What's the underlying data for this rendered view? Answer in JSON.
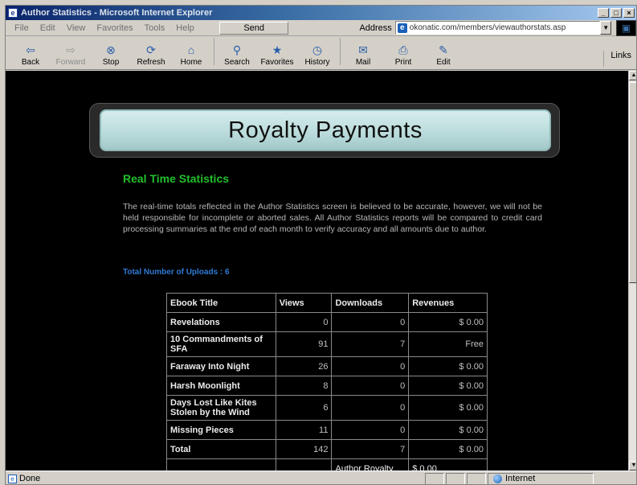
{
  "window": {
    "title": "Author Statistics - Microsoft Internet Explorer",
    "controls": [
      "_",
      "□",
      "×"
    ]
  },
  "menu": {
    "items": [
      "File",
      "Edit",
      "View",
      "Favorites",
      "Tools",
      "Help"
    ],
    "send_label": "Send",
    "address_label": "Address",
    "address_value": "okonatic.com/members/viewauthorstats.asp"
  },
  "toolbar": {
    "buttons": [
      {
        "label": "Back",
        "icon": "back-arrow-icon",
        "enabled": true
      },
      {
        "label": "Forward",
        "icon": "forward-arrow-icon",
        "enabled": false
      },
      {
        "label": "Stop",
        "icon": "stop-icon",
        "enabled": true
      },
      {
        "label": "Refresh",
        "icon": "refresh-icon",
        "enabled": true
      },
      {
        "label": "Home",
        "icon": "home-icon",
        "enabled": true
      },
      {
        "label": "Search",
        "icon": "search-icon",
        "enabled": true
      },
      {
        "label": "Favorites",
        "icon": "favorites-icon",
        "enabled": true
      },
      {
        "label": "History",
        "icon": "history-icon",
        "enabled": true
      },
      {
        "label": "Mail",
        "icon": "mail-icon",
        "enabled": true
      },
      {
        "label": "Print",
        "icon": "print-icon",
        "enabled": true
      },
      {
        "label": "Edit",
        "icon": "edit-icon",
        "enabled": true
      }
    ],
    "links_label": "Links"
  },
  "page": {
    "banner_title": "Royalty Payments",
    "heading": "Real Time Statistics",
    "paragraph": "The real-time totals reflected in the Author Statistics screen is believed to be accurate, however, we will not be held responsible for incomplete or aborted sales. All Author Statistics reports will be compared to credit card processing summaries at the end of each month to verify accuracy and all amounts due to author.",
    "uploads_text": "Total Number of Uploads : 6",
    "heading_color": "#22c02a",
    "link_color": "#2f7ad6"
  },
  "stats_table": {
    "headers": [
      "Ebook Title",
      "Views",
      "Downloads",
      "Revenues"
    ],
    "rows": [
      {
        "title": "Revelations",
        "views": "0",
        "downloads": "0",
        "revenues": "$ 0.00"
      },
      {
        "title": "10 Commandments of SFA",
        "views": "91",
        "downloads": "7",
        "revenues": "Free"
      },
      {
        "title": "Faraway Into Night",
        "views": "26",
        "downloads": "0",
        "revenues": "$ 0.00"
      },
      {
        "title": "Harsh Moonlight",
        "views": "8",
        "downloads": "0",
        "revenues": "$ 0.00"
      },
      {
        "title": "Days Lost Like Kites Stolen by the Wind",
        "views": "6",
        "downloads": "0",
        "revenues": "$ 0.00"
      },
      {
        "title": "Missing Pieces",
        "views": "11",
        "downloads": "0",
        "revenues": "$ 0.00"
      }
    ],
    "total": {
      "title": "Total",
      "views": "142",
      "downloads": "7",
      "revenues": "$ 0.00"
    },
    "royalty": {
      "label": "Author Royalty",
      "value": "$ 0.00"
    }
  },
  "statusbar": {
    "status": "Done",
    "zone": "Internet"
  }
}
